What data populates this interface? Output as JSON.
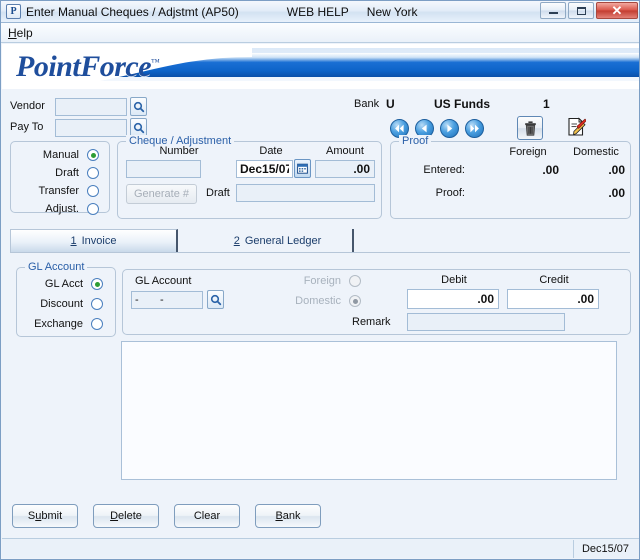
{
  "window": {
    "icon": "pointforce-p-icon",
    "title": "Enter Manual Cheques / Adjstmt (AP50)",
    "web_help": "WEB HELP",
    "location": "New York",
    "minimize": "minimize-icon",
    "maximize": "maximize-icon",
    "close": "close-icon"
  },
  "menubar": {
    "help": "Help",
    "help_accel": "H",
    "help_rest": "elp"
  },
  "banner": {
    "logo_point": "Point",
    "logo_force": "Force",
    "logo_tm": "™"
  },
  "vendor_section": {
    "vendor_label": "Vendor",
    "vendor_value": "",
    "pay_to_label": "Pay To",
    "pay_to_value": "",
    "lookup_icon": "magnifier-icon"
  },
  "bank_section": {
    "bank_label": "Bank",
    "bank_code": "U",
    "bank_name": "US Funds",
    "bank_number": "1",
    "nav_first": "first-record-icon",
    "nav_prev": "previous-record-icon",
    "nav_next": "next-record-icon",
    "nav_last": "last-record-icon",
    "delete_icon": "trash-icon",
    "notes_icon": "edit-note-icon"
  },
  "type_group": {
    "options": [
      {
        "label": "Manual",
        "selected": true
      },
      {
        "label": "Draft",
        "selected": false
      },
      {
        "label": "Transfer",
        "selected": false
      },
      {
        "label": "Adjust.",
        "selected": false
      }
    ]
  },
  "cheque_group": {
    "title": "Cheque / Adjustment",
    "number_label": "Number",
    "number_value": "",
    "date_label": "Date",
    "date_value": "Dec15/07",
    "calendar_icon": "calendar-icon",
    "amount_label": "Amount",
    "amount_value": ".00",
    "generate_label": "Generate #",
    "generate_disabled": true,
    "draft_label": "Draft",
    "draft_value": ""
  },
  "proof_group": {
    "title": "Proof",
    "col_foreign": "Foreign",
    "col_domestic": "Domestic",
    "rows": [
      {
        "label": "Entered:",
        "foreign": ".00",
        "domestic": ".00"
      },
      {
        "label": "Proof:",
        "foreign": "",
        "domestic": ".00"
      }
    ]
  },
  "tabs": [
    {
      "num": "1",
      "label": "Invoice",
      "active": true
    },
    {
      "num": "2",
      "label": "General Ledger",
      "active": false
    }
  ],
  "gl_group": {
    "title": "GL Account",
    "options": [
      {
        "label": "GL Acct",
        "selected": true
      },
      {
        "label": "Discount",
        "selected": false
      },
      {
        "label": "Exchange",
        "selected": false
      }
    ]
  },
  "detail_panel": {
    "gl_account_label": "GL Account",
    "gl_account_value": "-       -",
    "lookup_icon": "magnifier-icon",
    "foreign_label": "Foreign",
    "foreign_selected": false,
    "domestic_label": "Domestic",
    "domestic_selected": true,
    "currency_disabled": true,
    "debit_label": "Debit",
    "debit_value": ".00",
    "credit_label": "Credit",
    "credit_value": ".00",
    "remark_label": "Remark",
    "remark_value": ""
  },
  "buttons": [
    {
      "pre": "S",
      "accel": "u",
      "post": "bmit",
      "name": "submit-button"
    },
    {
      "pre": "",
      "accel": "D",
      "post": "elete",
      "name": "delete-button"
    },
    {
      "pre": "Clear",
      "accel": "",
      "post": "",
      "name": "clear-button"
    },
    {
      "pre": "",
      "accel": "B",
      "post": "ank",
      "name": "bank-button"
    }
  ],
  "statusbar": {
    "date": "Dec15/07"
  },
  "colors": {
    "accent_blue": "#1f4e9c",
    "group_title": "#2a5fa8",
    "field_bg": "#e9f0f8",
    "radio_dot_green": "#2e9d35"
  }
}
